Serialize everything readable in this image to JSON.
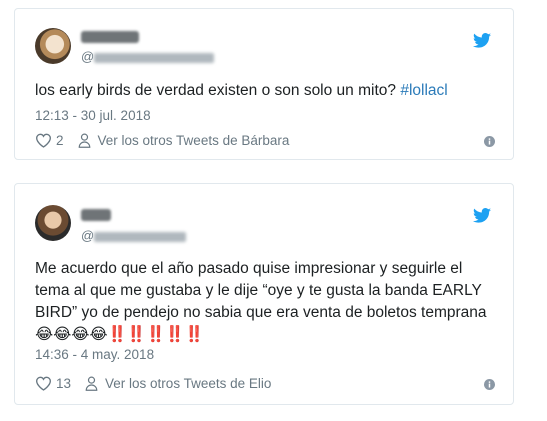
{
  "tweets": [
    {
      "handle": "@",
      "text": "los early birds de verdad existen o son solo un mito?",
      "hashtag": "#lollacl",
      "timestamp": "12:13 - 30 jul. 2018",
      "likes": "2",
      "see_more": "Ver los otros Tweets de Bárbara"
    },
    {
      "handle": "@",
      "text": "Me acuerdo que el año pasado quise impresionar y seguirle el tema al que me gustaba y le dije “oye y te gusta la banda EARLY BIRD” yo de pendejo no sabia que era venta de boletos temprana",
      "emojis": "😂😂😂😂‼️‼️‼️‼️‼️",
      "timestamp": "14:36 - 4 may. 2018",
      "likes": "13",
      "see_more": "Ver los otros Tweets de Elio"
    }
  ],
  "icons": {
    "brand": "twitter-bird-icon",
    "like": "heart-icon",
    "profile": "person-icon",
    "info": "info-icon"
  },
  "colors": {
    "twitter_blue": "#1da1f2",
    "link_blue": "#2b7bb9",
    "meta_gray": "#697882",
    "border": "#e1e8ed"
  }
}
